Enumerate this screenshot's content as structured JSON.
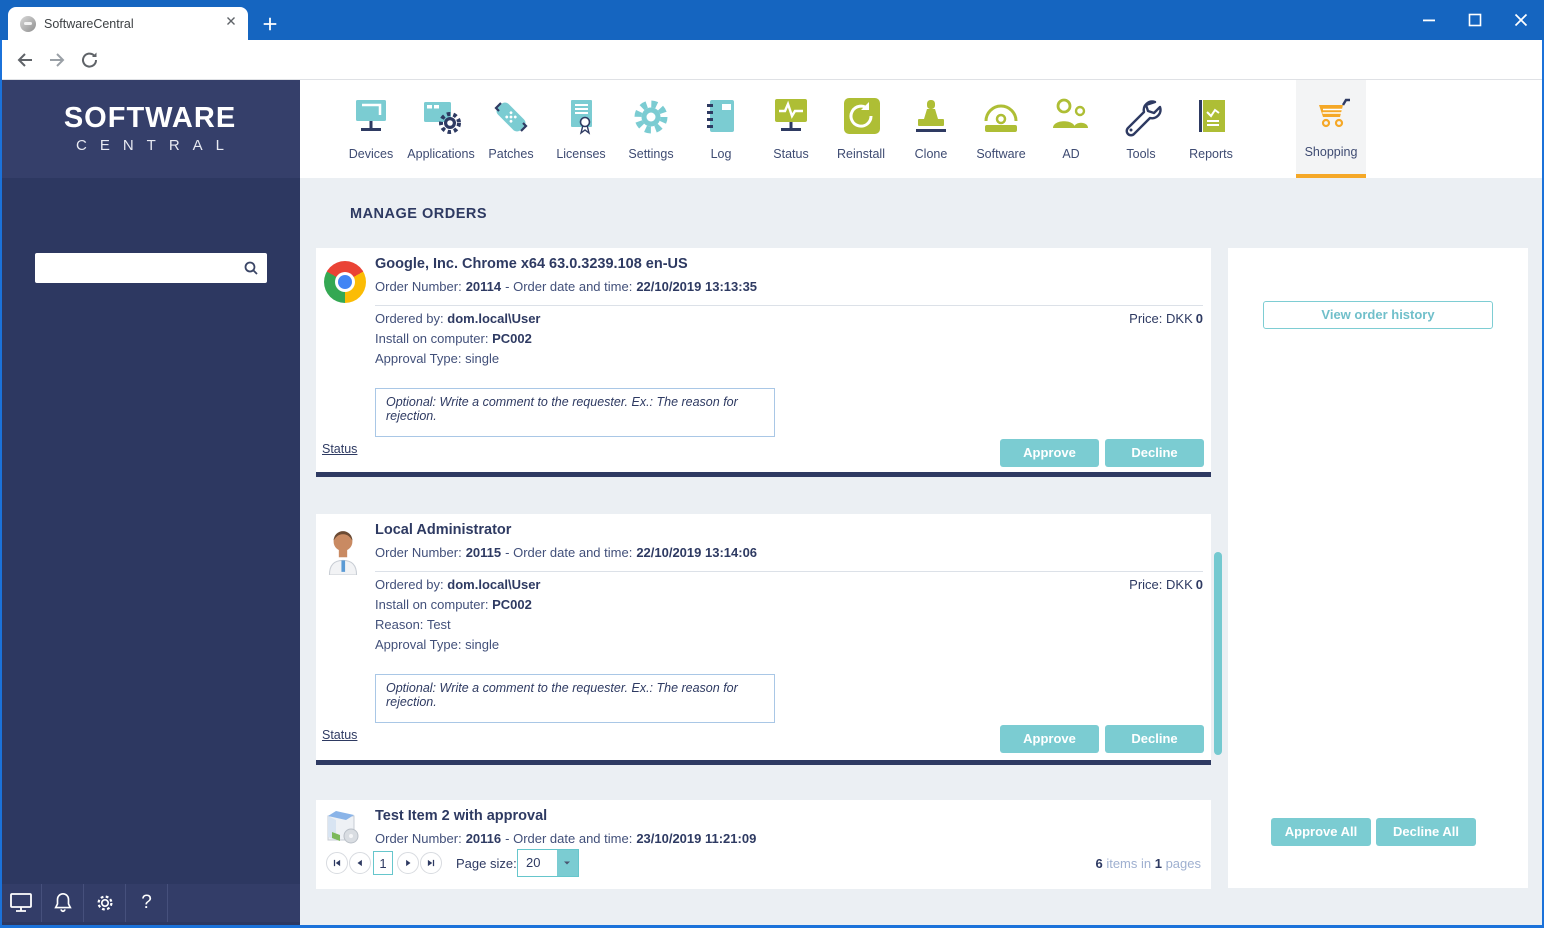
{
  "browser": {
    "tab_title": "SoftwareCentral",
    "url": "softwarecentral/ManageOrders"
  },
  "sidebar": {
    "logo_top": "SOFTWARE",
    "logo_bottom": "CENTRAL",
    "search_value": "",
    "help_glyph": "?"
  },
  "nav": {
    "active": "Shopping",
    "items": [
      {
        "label": "Devices"
      },
      {
        "label": "Applications"
      },
      {
        "label": "Patches"
      },
      {
        "label": "Licenses"
      },
      {
        "label": "Settings"
      },
      {
        "label": "Log"
      },
      {
        "label": "Status"
      },
      {
        "label": "Reinstall"
      },
      {
        "label": "Clone"
      },
      {
        "label": "Software"
      },
      {
        "label": "AD"
      },
      {
        "label": "Tools"
      },
      {
        "label": "Reports"
      },
      {
        "label": "Shopping"
      }
    ]
  },
  "page": {
    "title": "MANAGE ORDERS"
  },
  "labels": {
    "order_number": "Order Number:",
    "order_date": "- Order date and time:",
    "ordered_by": "Ordered by:",
    "install_on": "Install on computer:",
    "reason": "Reason:",
    "approval_type": "Approval Type:",
    "price": "Price:",
    "status": "Status",
    "comment_placeholder": "Optional: Write a comment to the requester. Ex.: The reason for rejection.",
    "approve": "Approve",
    "decline": "Decline"
  },
  "orders": [
    {
      "title": "Google, Inc. Chrome x64 63.0.3239.108 en-US",
      "number": "20114",
      "datetime": "22/10/2019 13:13:35",
      "ordered_by": "dom.local\\User",
      "computer": "PC002",
      "approval_type": "single",
      "currency": "DKK",
      "amount": "0"
    },
    {
      "title": "Local Administrator",
      "number": "20115",
      "datetime": "22/10/2019 13:14:06",
      "ordered_by": "dom.local\\User",
      "computer": "PC002",
      "reason": "Test",
      "approval_type": "single",
      "currency": "DKK",
      "amount": "0"
    },
    {
      "title": "Test Item 2 with approval",
      "number": "20116",
      "datetime": "23/10/2019 11:21:09"
    }
  ],
  "pagination": {
    "current_page": "1",
    "page_size_label": "Page size:",
    "page_size": "20",
    "total_items": "6",
    "items_text": " items in ",
    "total_pages": "1",
    "pages_text": " pages"
  },
  "right_panel": {
    "view_history": "View order history",
    "approve_all": "Approve All",
    "decline_all": "Decline All"
  },
  "colors": {
    "navy": "#2e3a62",
    "teal": "#7bccd2",
    "olive": "#aebe35",
    "orange": "#f5a827",
    "chrome_blue": "#1565c0"
  }
}
